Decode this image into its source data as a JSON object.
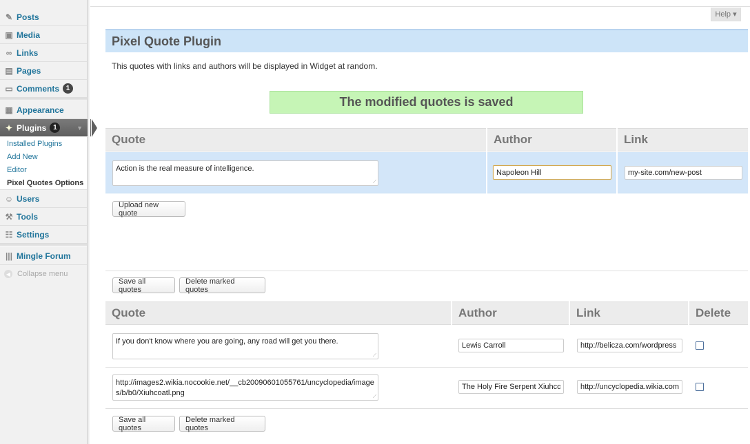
{
  "sidebar": {
    "items": [
      {
        "label": "Posts"
      },
      {
        "label": "Media"
      },
      {
        "label": "Links"
      },
      {
        "label": "Pages"
      },
      {
        "label": "Comments",
        "badge": "1"
      },
      {
        "label": "Appearance"
      },
      {
        "label": "Plugins",
        "badge": "1"
      },
      {
        "label": "Users"
      },
      {
        "label": "Tools"
      },
      {
        "label": "Settings"
      },
      {
        "label": "Mingle Forum"
      }
    ],
    "submenu": [
      "Installed Plugins",
      "Add New",
      "Editor",
      "Pixel Quotes Options"
    ],
    "collapse": "Collapse menu"
  },
  "header": {
    "help": "Help ▾"
  },
  "page": {
    "title": "Pixel Quote Plugin",
    "description": "This quotes with links and authors will be displayed in Widget at random.",
    "notice": "The modified quotes is saved"
  },
  "new_quote": {
    "headers": {
      "quote": "Quote",
      "author": "Author",
      "link": "Link"
    },
    "quote": "Action is the real measure of intelligence.",
    "author": "Napoleon Hill",
    "link": "my-site.com/new-post",
    "upload_button": "Upload new quote"
  },
  "quotes_list": {
    "save_button": "Save all quotes",
    "delete_button": "Delete marked quotes",
    "headers": {
      "quote": "Quote",
      "author": "Author",
      "link": "Link",
      "delete": "Delete"
    },
    "rows": [
      {
        "quote": "If you don't know where you are going, any road will get you there.",
        "author": "Lewis Carroll",
        "link": "http://belicza.com/wordpress"
      },
      {
        "quote": "http://images2.wikia.nocookie.net/__cb20090601055761/uncyclopedia/images/b/b0/Xiuhcoatl.png",
        "author": "The Holy Fire Serpent Xiuhcoatl",
        "link": "http://uncyclopedia.wikia.com/wiki/Xiuhcoatl"
      }
    ]
  },
  "colors": {
    "accent": "#21759b",
    "notice_bg": "#c6f5b6",
    "title_bg": "#cde4f8"
  }
}
